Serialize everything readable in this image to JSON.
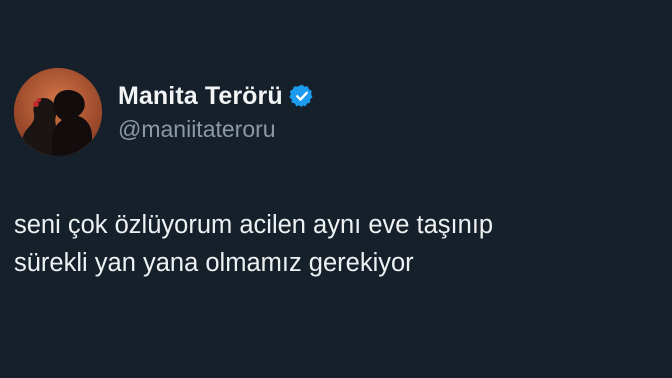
{
  "tweet": {
    "author": {
      "display_name": "Manita Terörü",
      "handle": "@maniitateroru",
      "verified": true,
      "avatar_icon": "silhouette-couple-avatar",
      "badge_icon": "verified-badge-icon"
    },
    "text_lines": [
      "seni çok özlüyorum acilen aynı eve taşınıp",
      "sürekli yan yana olmamız gerekiyor"
    ]
  },
  "colors": {
    "background": "#16202b",
    "text_primary": "#eef1f2",
    "text_secondary": "#8b98a5",
    "verified_blue": "#1d9bf0",
    "avatar_bg": "#b65a36"
  }
}
